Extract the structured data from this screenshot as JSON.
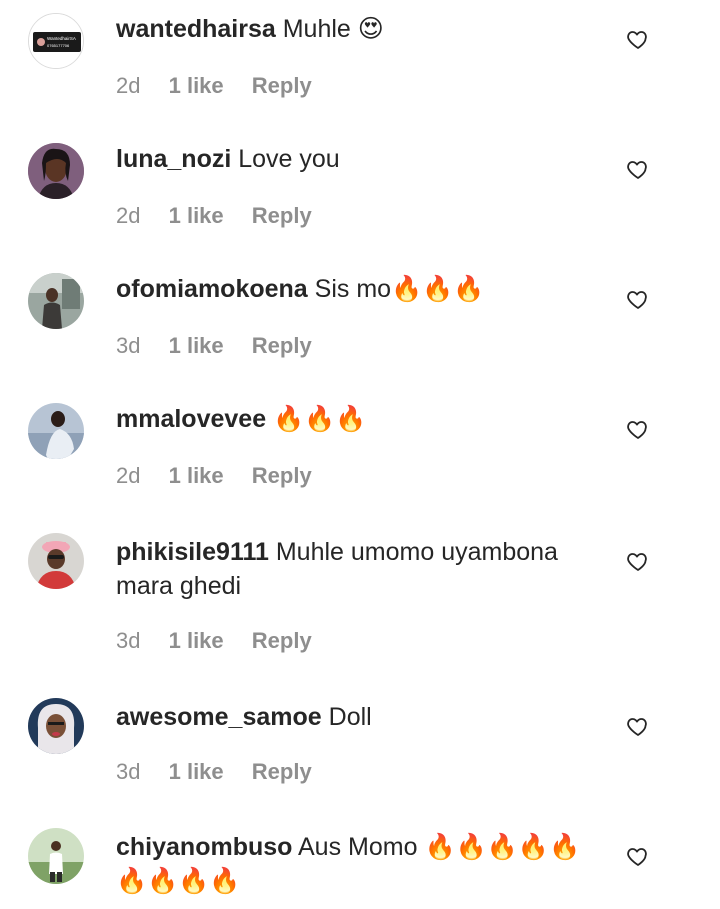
{
  "comments": [
    {
      "username": "wantedhairsa",
      "text": "Muhle",
      "emoji": "😍",
      "time": "2d",
      "likes": "1 like",
      "reply": "Reply"
    },
    {
      "username": "luna_nozi",
      "text": "Love you",
      "emoji": "",
      "time": "2d",
      "likes": "1 like",
      "reply": "Reply"
    },
    {
      "username": "ofomiamokoena",
      "text": "Sis mo",
      "emoji": "🔥🔥🔥",
      "time": "3d",
      "likes": "1 like",
      "reply": "Reply"
    },
    {
      "username": "mmalovevee",
      "text": "",
      "emoji": "🔥🔥🔥",
      "time": "2d",
      "likes": "1 like",
      "reply": "Reply"
    },
    {
      "username": "phikisile9111",
      "text": "Muhle umomo uyambona mara ghedi",
      "emoji": "",
      "time": "3d",
      "likes": "1 like",
      "reply": "Reply"
    },
    {
      "username": "awesome_samoe",
      "text": "Doll",
      "emoji": "",
      "time": "3d",
      "likes": "1 like",
      "reply": "Reply"
    },
    {
      "username": "chiyanombuso",
      "text": "Aus Momo",
      "emoji": "🔥🔥🔥🔥🔥 🔥🔥🔥🔥",
      "time": "",
      "likes": "",
      "reply": ""
    }
  ],
  "avatar_badge": {
    "line1": "WantedhairSA",
    "line2": "0765177706"
  },
  "icons": {
    "like": "heart-outline-icon"
  },
  "colors": {
    "text": "#262626",
    "meta": "#8e8e8e",
    "background": "#ffffff"
  }
}
